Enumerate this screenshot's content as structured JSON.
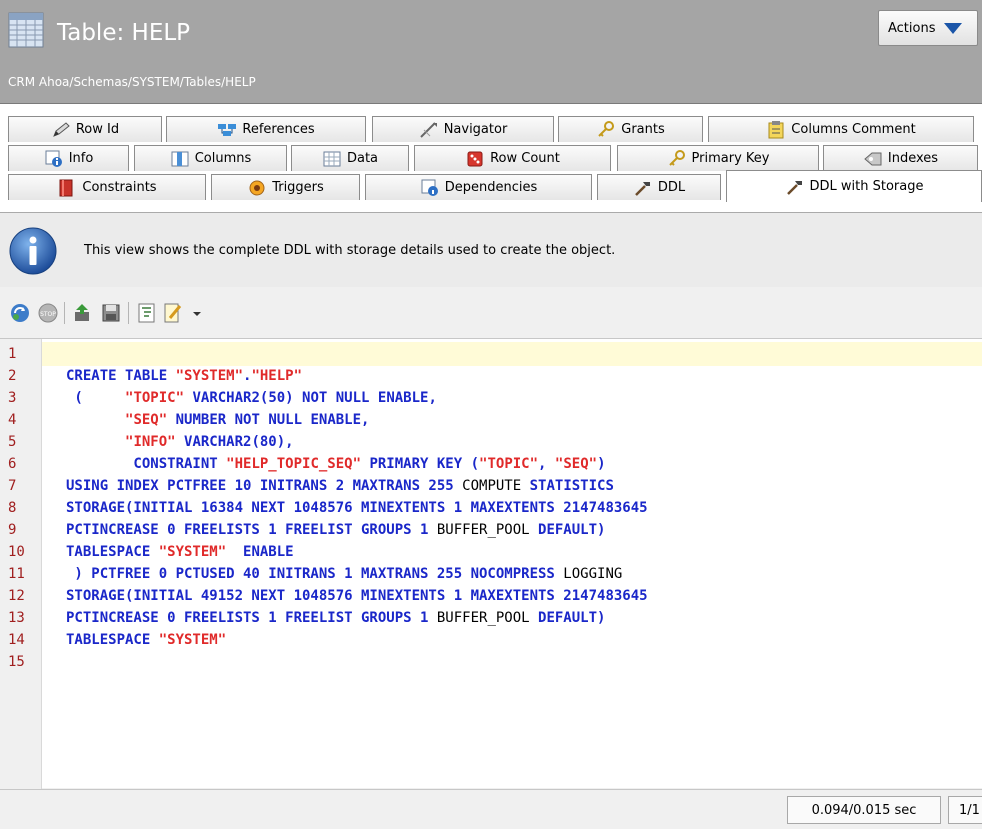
{
  "header": {
    "title": "Table: HELP",
    "path": "CRM Ahoa/Schemas/SYSTEM/Tables/HELP",
    "actions_label": "Actions"
  },
  "tabs": {
    "row1": [
      "Row Id",
      "References",
      "Navigator",
      "Grants",
      "Columns Comment"
    ],
    "row2": [
      "Info",
      "Columns",
      "Data",
      "Row Count",
      "Primary Key",
      "Indexes"
    ],
    "row3": [
      "Constraints",
      "Triggers",
      "Dependencies",
      "DDL",
      "DDL with Storage"
    ],
    "active": "DDL with Storage"
  },
  "info": {
    "text": "This view shows the complete DDL with storage details used to create the object."
  },
  "editor": {
    "line_numbers": [
      "1",
      "2",
      "3",
      "4",
      "5",
      "6",
      "7",
      "8",
      "9",
      "10",
      "11",
      "12",
      "13",
      "14",
      "15"
    ],
    "lines": [
      "",
      "CREATE TABLE \"SYSTEM\".\"HELP\"",
      " (     \"TOPIC\" VARCHAR2(50) NOT NULL ENABLE,",
      "       \"SEQ\" NUMBER NOT NULL ENABLE,",
      "       \"INFO\" VARCHAR2(80),",
      "        CONSTRAINT \"HELP_TOPIC_SEQ\" PRIMARY KEY (\"TOPIC\", \"SEQ\")",
      "USING INDEX PCTFREE 10 INITRANS 2 MAXTRANS 255 COMPUTE STATISTICS",
      "STORAGE(INITIAL 16384 NEXT 1048576 MINEXTENTS 1 MAXEXTENTS 2147483645",
      "PCTINCREASE 0 FREELISTS 1 FREELIST GROUPS 1 BUFFER_POOL DEFAULT)",
      "TABLESPACE \"SYSTEM\"  ENABLE",
      " ) PCTFREE 0 PCTUSED 40 INITRANS 1 MAXTRANS 255 NOCOMPRESS LOGGING",
      "STORAGE(INITIAL 49152 NEXT 1048576 MINEXTENTS 1 MAXEXTENTS 2147483645",
      "PCTINCREASE 0 FREELISTS 1 FREELIST GROUPS 1 BUFFER_POOL DEFAULT)",
      "TABLESPACE \"SYSTEM\"",
      ""
    ]
  },
  "status": {
    "timing": "0.094/0.015 sec",
    "page": "1/1"
  },
  "colors": {
    "keyword": "#1a27c9",
    "string": "#e02a2a",
    "line_number": "#a01f1f",
    "current_line": "#fffbd7",
    "header_bg": "#a5a5a5"
  }
}
